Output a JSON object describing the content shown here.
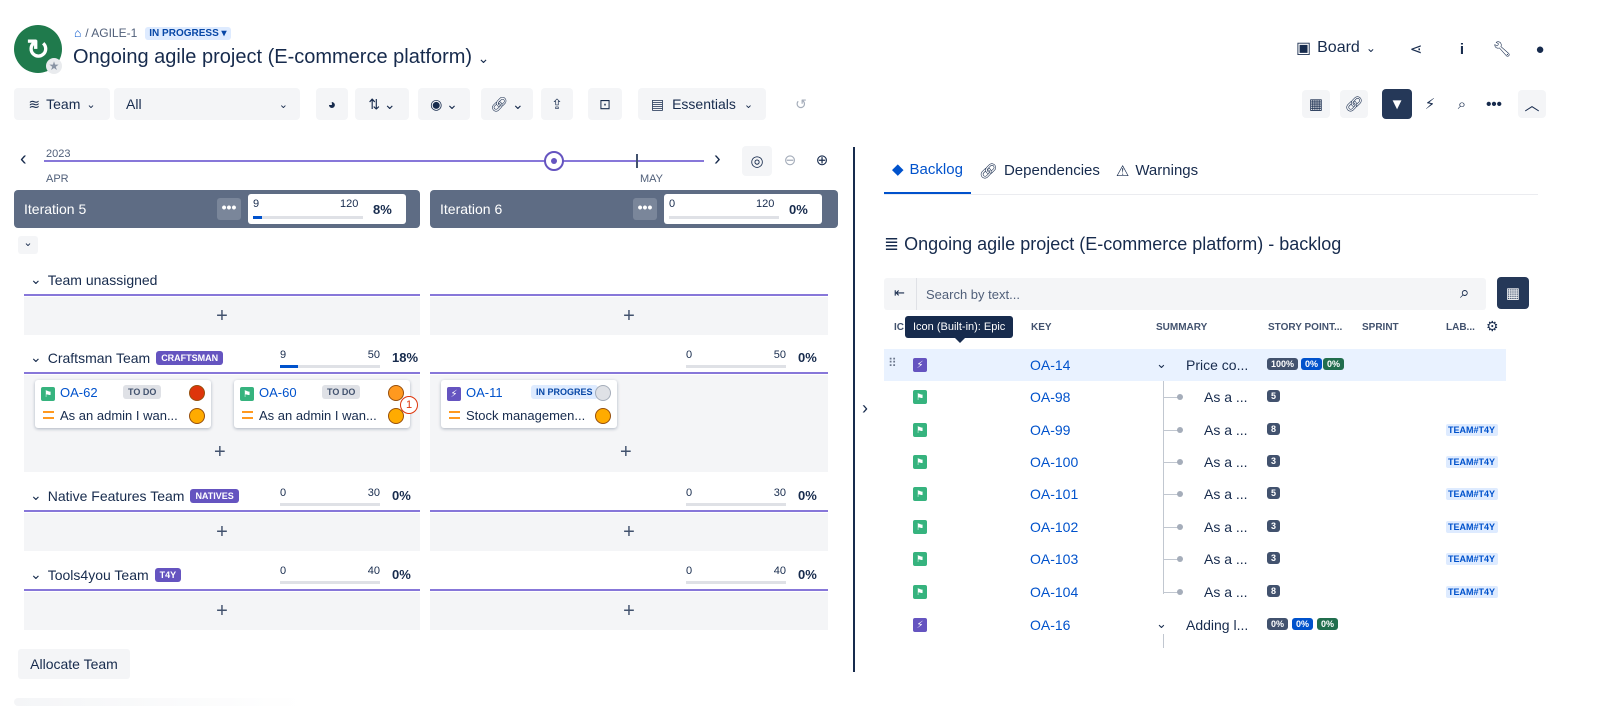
{
  "header": {
    "breadcrumb_key": "/ AGILE-1",
    "status": "IN PROGRESS",
    "title": "Ongoing agile project (E-commerce platform)",
    "view_label": "Board"
  },
  "toolbar": {
    "team_label": "Team",
    "filter_value": "All",
    "essentials_label": "Essentials"
  },
  "timeline": {
    "year": "2023",
    "month_start": "APR",
    "month_next": "MAY"
  },
  "iterations": [
    {
      "name": "Iteration 5",
      "used": "9",
      "capacity": "120",
      "pct": "8%",
      "fill": 0.08
    },
    {
      "name": "Iteration 6",
      "used": "0",
      "capacity": "120",
      "pct": "0%",
      "fill": 0
    }
  ],
  "teams": [
    {
      "name": "Team unassigned",
      "tag": ""
    },
    {
      "name": "Craftsman Team",
      "tag": "CRAFTSMAN",
      "caps": [
        {
          "used": "9",
          "capacity": "50",
          "pct": "18%",
          "fill": 0.18
        },
        {
          "used": "0",
          "capacity": "50",
          "pct": "0%",
          "fill": 0
        }
      ]
    },
    {
      "name": "Native Features Team",
      "tag": "NATIVES",
      "caps": [
        {
          "used": "0",
          "capacity": "30",
          "pct": "0%",
          "fill": 0
        },
        {
          "used": "0",
          "capacity": "30",
          "pct": "0%",
          "fill": 0
        }
      ]
    },
    {
      "name": "Tools4you Team",
      "tag": "T4Y",
      "caps": [
        {
          "used": "0",
          "capacity": "40",
          "pct": "0%",
          "fill": 0
        },
        {
          "used": "0",
          "capacity": "40",
          "pct": "0%",
          "fill": 0
        }
      ]
    }
  ],
  "cards": [
    {
      "key": "OA-62",
      "status": "TO DO",
      "summary": "As an admin I wan..."
    },
    {
      "key": "OA-60",
      "status": "TO DO",
      "summary": "As an admin I wan...",
      "badge": "1"
    },
    {
      "key": "OA-11",
      "status": "IN PROGRES",
      "summary": "Stock managemen..."
    }
  ],
  "allocate_label": "Allocate Team",
  "right_panel": {
    "tabs": [
      "Backlog",
      "Dependencies",
      "Warnings"
    ],
    "title": "Ongoing agile project (E-commerce platform) - backlog",
    "search_placeholder": "Search by text...",
    "tooltip": "Icon (Built-in): Epic",
    "columns": {
      "icon": "IC",
      "key": "KEY",
      "summary": "SUMMARY",
      "points": "STORY POINT...",
      "sprint": "SPRINT",
      "labels": "LAB..."
    },
    "rows": [
      {
        "type": "epic",
        "key": "OA-14",
        "summary": "Price co...",
        "badges": [
          "100%",
          "0%",
          "0%"
        ],
        "label": ""
      },
      {
        "type": "story",
        "key": "OA-98",
        "summary": "As a ...",
        "points": "5",
        "label": ""
      },
      {
        "type": "story",
        "key": "OA-99",
        "summary": "As a ...",
        "points": "8",
        "label": "TEAM#T4Y"
      },
      {
        "type": "story",
        "key": "OA-100",
        "summary": "As a ...",
        "points": "3",
        "label": "TEAM#T4Y"
      },
      {
        "type": "story",
        "key": "OA-101",
        "summary": "As a ...",
        "points": "5",
        "label": "TEAM#T4Y"
      },
      {
        "type": "story",
        "key": "OA-102",
        "summary": "As a ...",
        "points": "3",
        "label": "TEAM#T4Y"
      },
      {
        "type": "story",
        "key": "OA-103",
        "summary": "As a ...",
        "points": "3",
        "label": "TEAM#T4Y"
      },
      {
        "type": "story",
        "key": "OA-104",
        "summary": "As a ...",
        "points": "8",
        "label": "TEAM#T4Y"
      },
      {
        "type": "epic",
        "key": "OA-16",
        "summary": "Adding l...",
        "badges": [
          "0%",
          "0%",
          "0%"
        ],
        "label": ""
      }
    ]
  }
}
